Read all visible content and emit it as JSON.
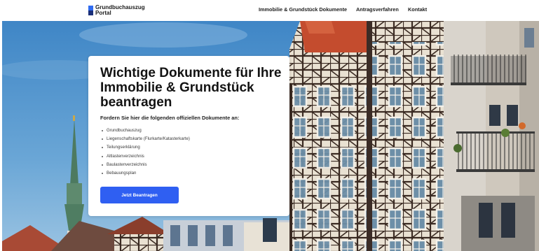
{
  "header": {
    "logo_line1": "Grundbuchauszug",
    "logo_line2": "Portal",
    "nav": [
      {
        "label": "Immobilie & Grundstück Dokumente"
      },
      {
        "label": "Antragsverfahren"
      },
      {
        "label": "Kontakt"
      }
    ]
  },
  "hero": {
    "title": "Wichtige Dokumente für Ihre Immobilie & Grundstück beantragen",
    "subtitle": "Fordern Sie hier die folgenden offiziellen Dokumente an:",
    "documents": [
      "Grundbuchauszug",
      "Liegenschaftskarte (Flurkarte/Katasterkarte)",
      "Teilungserklärung",
      "Altlastenverzeichnis",
      "Baulastenverzeichnis",
      "Bebauungsplan"
    ],
    "cta_label": "Jetzt Beantragen"
  },
  "colors": {
    "accent": "#2f5ff2",
    "logo_primary": "#2f6bf0",
    "logo_secondary": "#1a2f7a"
  }
}
